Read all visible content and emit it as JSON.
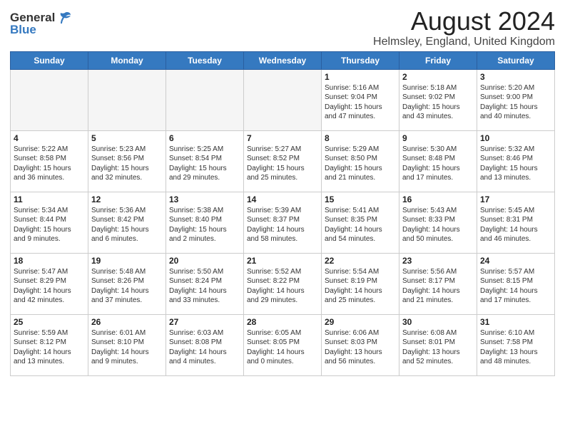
{
  "logo": {
    "general": "General",
    "blue": "Blue"
  },
  "title": "August 2024",
  "subtitle": "Helmsley, England, United Kingdom",
  "weekdays": [
    "Sunday",
    "Monday",
    "Tuesday",
    "Wednesday",
    "Thursday",
    "Friday",
    "Saturday"
  ],
  "weeks": [
    [
      {
        "day": "",
        "info": ""
      },
      {
        "day": "",
        "info": ""
      },
      {
        "day": "",
        "info": ""
      },
      {
        "day": "",
        "info": ""
      },
      {
        "day": "1",
        "info": "Sunrise: 5:16 AM\nSunset: 9:04 PM\nDaylight: 15 hours\nand 47 minutes."
      },
      {
        "day": "2",
        "info": "Sunrise: 5:18 AM\nSunset: 9:02 PM\nDaylight: 15 hours\nand 43 minutes."
      },
      {
        "day": "3",
        "info": "Sunrise: 5:20 AM\nSunset: 9:00 PM\nDaylight: 15 hours\nand 40 minutes."
      }
    ],
    [
      {
        "day": "4",
        "info": "Sunrise: 5:22 AM\nSunset: 8:58 PM\nDaylight: 15 hours\nand 36 minutes."
      },
      {
        "day": "5",
        "info": "Sunrise: 5:23 AM\nSunset: 8:56 PM\nDaylight: 15 hours\nand 32 minutes."
      },
      {
        "day": "6",
        "info": "Sunrise: 5:25 AM\nSunset: 8:54 PM\nDaylight: 15 hours\nand 29 minutes."
      },
      {
        "day": "7",
        "info": "Sunrise: 5:27 AM\nSunset: 8:52 PM\nDaylight: 15 hours\nand 25 minutes."
      },
      {
        "day": "8",
        "info": "Sunrise: 5:29 AM\nSunset: 8:50 PM\nDaylight: 15 hours\nand 21 minutes."
      },
      {
        "day": "9",
        "info": "Sunrise: 5:30 AM\nSunset: 8:48 PM\nDaylight: 15 hours\nand 17 minutes."
      },
      {
        "day": "10",
        "info": "Sunrise: 5:32 AM\nSunset: 8:46 PM\nDaylight: 15 hours\nand 13 minutes."
      }
    ],
    [
      {
        "day": "11",
        "info": "Sunrise: 5:34 AM\nSunset: 8:44 PM\nDaylight: 15 hours\nand 9 minutes."
      },
      {
        "day": "12",
        "info": "Sunrise: 5:36 AM\nSunset: 8:42 PM\nDaylight: 15 hours\nand 6 minutes."
      },
      {
        "day": "13",
        "info": "Sunrise: 5:38 AM\nSunset: 8:40 PM\nDaylight: 15 hours\nand 2 minutes."
      },
      {
        "day": "14",
        "info": "Sunrise: 5:39 AM\nSunset: 8:37 PM\nDaylight: 14 hours\nand 58 minutes."
      },
      {
        "day": "15",
        "info": "Sunrise: 5:41 AM\nSunset: 8:35 PM\nDaylight: 14 hours\nand 54 minutes."
      },
      {
        "day": "16",
        "info": "Sunrise: 5:43 AM\nSunset: 8:33 PM\nDaylight: 14 hours\nand 50 minutes."
      },
      {
        "day": "17",
        "info": "Sunrise: 5:45 AM\nSunset: 8:31 PM\nDaylight: 14 hours\nand 46 minutes."
      }
    ],
    [
      {
        "day": "18",
        "info": "Sunrise: 5:47 AM\nSunset: 8:29 PM\nDaylight: 14 hours\nand 42 minutes."
      },
      {
        "day": "19",
        "info": "Sunrise: 5:48 AM\nSunset: 8:26 PM\nDaylight: 14 hours\nand 37 minutes."
      },
      {
        "day": "20",
        "info": "Sunrise: 5:50 AM\nSunset: 8:24 PM\nDaylight: 14 hours\nand 33 minutes."
      },
      {
        "day": "21",
        "info": "Sunrise: 5:52 AM\nSunset: 8:22 PM\nDaylight: 14 hours\nand 29 minutes."
      },
      {
        "day": "22",
        "info": "Sunrise: 5:54 AM\nSunset: 8:19 PM\nDaylight: 14 hours\nand 25 minutes."
      },
      {
        "day": "23",
        "info": "Sunrise: 5:56 AM\nSunset: 8:17 PM\nDaylight: 14 hours\nand 21 minutes."
      },
      {
        "day": "24",
        "info": "Sunrise: 5:57 AM\nSunset: 8:15 PM\nDaylight: 14 hours\nand 17 minutes."
      }
    ],
    [
      {
        "day": "25",
        "info": "Sunrise: 5:59 AM\nSunset: 8:12 PM\nDaylight: 14 hours\nand 13 minutes."
      },
      {
        "day": "26",
        "info": "Sunrise: 6:01 AM\nSunset: 8:10 PM\nDaylight: 14 hours\nand 9 minutes."
      },
      {
        "day": "27",
        "info": "Sunrise: 6:03 AM\nSunset: 8:08 PM\nDaylight: 14 hours\nand 4 minutes."
      },
      {
        "day": "28",
        "info": "Sunrise: 6:05 AM\nSunset: 8:05 PM\nDaylight: 14 hours\nand 0 minutes."
      },
      {
        "day": "29",
        "info": "Sunrise: 6:06 AM\nSunset: 8:03 PM\nDaylight: 13 hours\nand 56 minutes."
      },
      {
        "day": "30",
        "info": "Sunrise: 6:08 AM\nSunset: 8:01 PM\nDaylight: 13 hours\nand 52 minutes."
      },
      {
        "day": "31",
        "info": "Sunrise: 6:10 AM\nSunset: 7:58 PM\nDaylight: 13 hours\nand 48 minutes."
      }
    ]
  ]
}
